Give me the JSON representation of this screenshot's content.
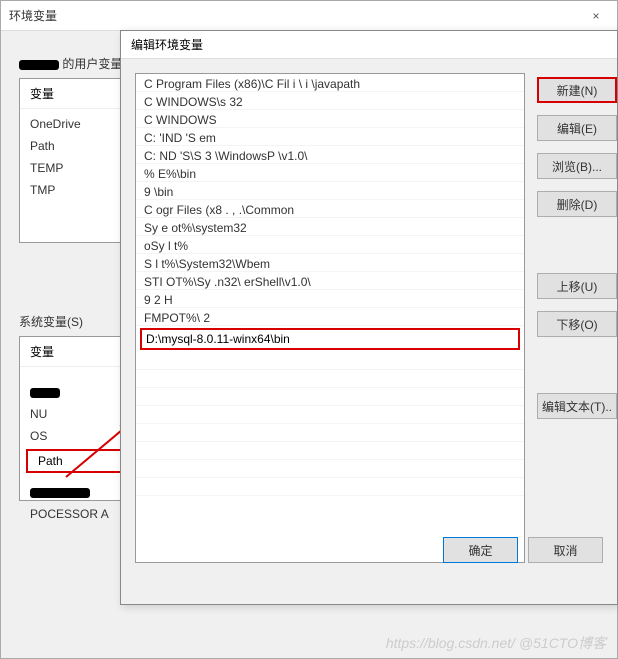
{
  "parent_dialog": {
    "title": "环境变量",
    "close_label": "×",
    "user_vars_section_prefix": "的用户变量",
    "column_variable": "变量",
    "user_vars": [
      "OneDrive",
      "Path",
      "TEMP",
      "TMP"
    ],
    "sys_vars_label": "系统变量(S)",
    "sys_vars_partial": [
      "NU",
      "OS",
      "Path",
      "POCESSOR A"
    ],
    "ok_label": "确定",
    "cancel_label": "取消"
  },
  "edit_dialog": {
    "title": "编辑环境变量",
    "entries": [
      "C   Program Files (x86)\\C                Fil       i       \\   i    \\javapath",
      "C   WINDOWS\\s         32",
      "C   WINDOWS",
      "C:   'IND   'S                           em",
      "C:     ND    'S\\S         3 \\WindowsP              \\v1.0\\",
      "%               E%\\bin",
      "9                   \\bin",
      "C    ogr     Files (x8                                   . ,  .\\Common",
      "   Sy  e       ot%\\system32",
      "   oSy     l     t%",
      "   S      l     t%\\System32\\Wbem",
      "     STI      OT%\\Sy    .n32\\                       erShell\\v1.0\\",
      "9      2   H",
      "      FMPOT%\\ 2"
    ],
    "highlighted_entry": "D:\\mysql-8.0.11-winx64\\bin",
    "buttons": {
      "new": "新建(N)",
      "edit": "编辑(E)",
      "browse": "浏览(B)...",
      "delete": "删除(D)",
      "move_up": "上移(U)",
      "move_down": "下移(O)",
      "edit_text": "编辑文本(T)..",
      "ok": "确定",
      "cancel": "取消"
    }
  },
  "watermark": "https://blog.csdn.net/  @51CTO博客"
}
